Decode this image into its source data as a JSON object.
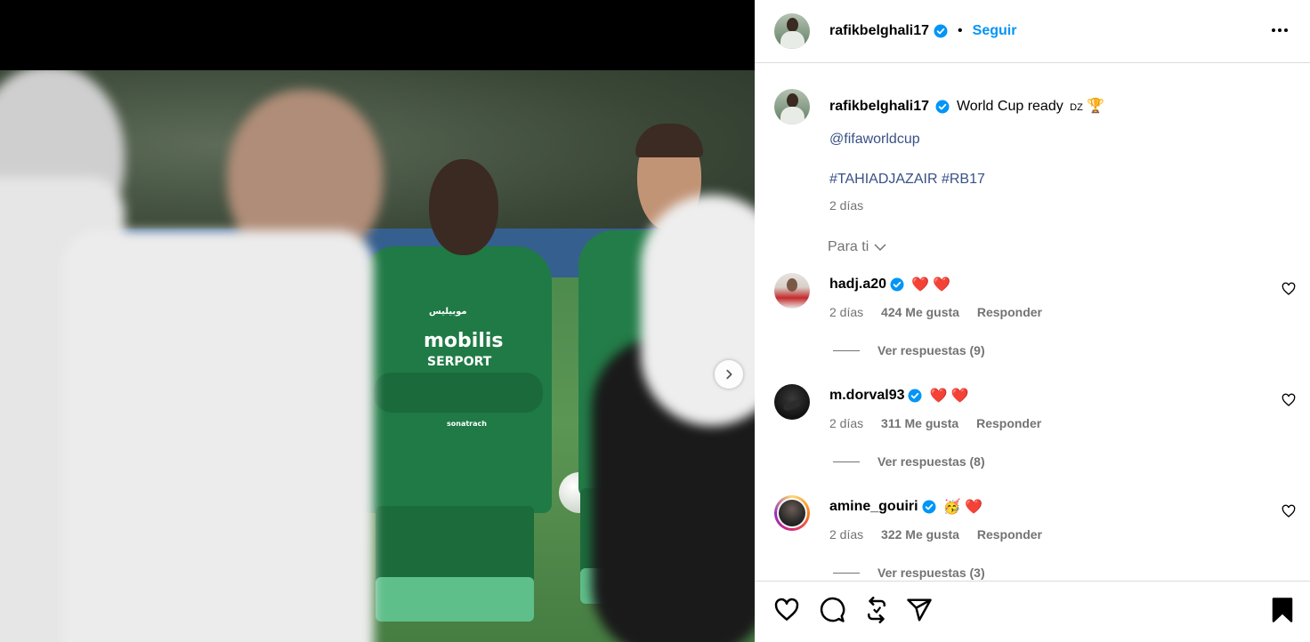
{
  "post": {
    "username": "rafikbelghali17",
    "follow_label": "Seguir",
    "caption": {
      "username": "rafikbelghali17",
      "text": "World Cup ready",
      "flag_text": "DZ",
      "trophy": "🏆",
      "mention": "@fifaworldcup",
      "hashtags": "#TAHIADJAZAIR #RB17",
      "time": "2 días"
    },
    "for_you_label": "Para ti",
    "photo": {
      "sponsor_arabic": "موبيليس",
      "sponsor_main": "mobilis",
      "sponsor_sub": "SERPORT",
      "sponsor_bottom": "sonatrach"
    }
  },
  "comments": [
    {
      "username": "hadj.a20",
      "emoji": "❤️ ❤️",
      "time": "2 días",
      "likes": "424 Me gusta",
      "reply_label": "Responder",
      "view_replies": "Ver respuestas (9)"
    },
    {
      "username": "m.dorval93",
      "emoji": "❤️ ❤️",
      "time": "2 días",
      "likes": "311 Me gusta",
      "reply_label": "Responder",
      "view_replies": "Ver respuestas (8)"
    },
    {
      "username": "amine_gouiri",
      "emoji": "🥳 ❤️",
      "time": "2 días",
      "likes": "322 Me gusta",
      "reply_label": "Responder",
      "view_replies": "Ver respuestas (3)"
    }
  ],
  "colors": {
    "accent": "#0095f6",
    "link": "#385185",
    "muted": "#737373",
    "heart": "#ff3040",
    "verified": "#0095f6"
  },
  "icons": {
    "like": "heart-icon",
    "comment": "comment-icon",
    "repost": "repost-icon",
    "share": "share-icon",
    "save": "bookmark-icon",
    "more": "more-horizontal-icon",
    "next": "chevron-right-icon"
  }
}
